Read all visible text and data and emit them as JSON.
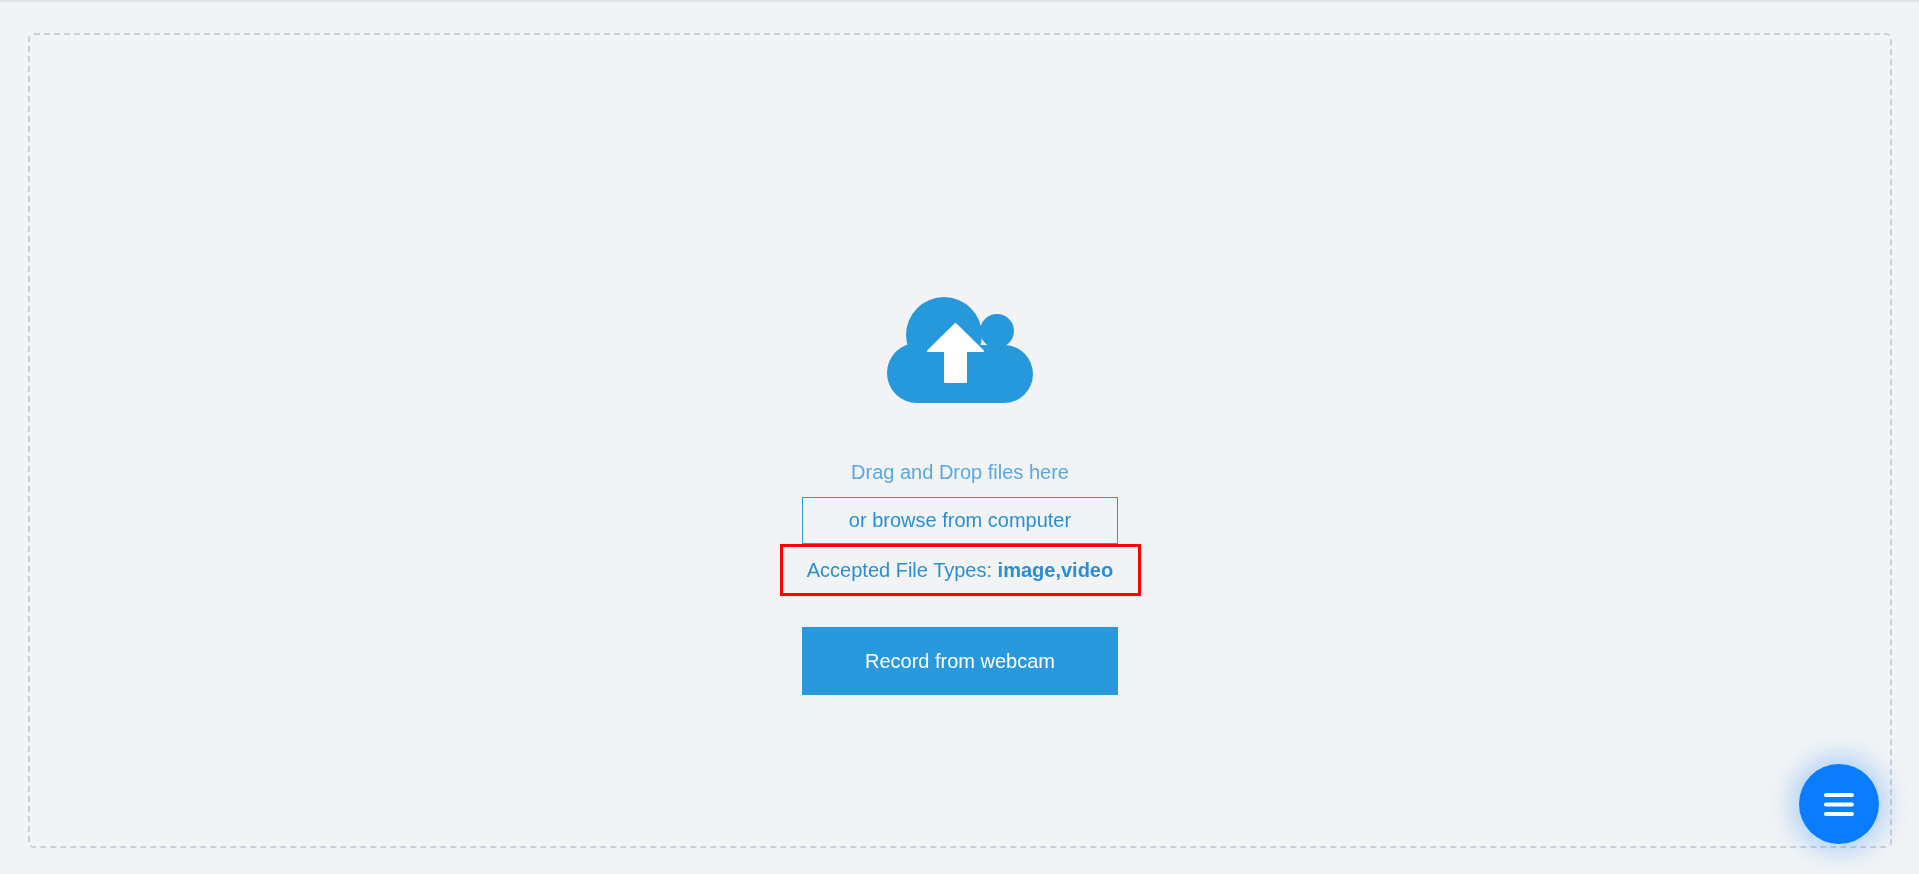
{
  "upload_area": {
    "drop_hint": "Drag and Drop files here",
    "browse_button": "or browse from computer",
    "accepted_types": {
      "text": "Accepted File Types: **image,video**",
      "highlighted": true
    },
    "record_button": "Record from webcam"
  }
}
